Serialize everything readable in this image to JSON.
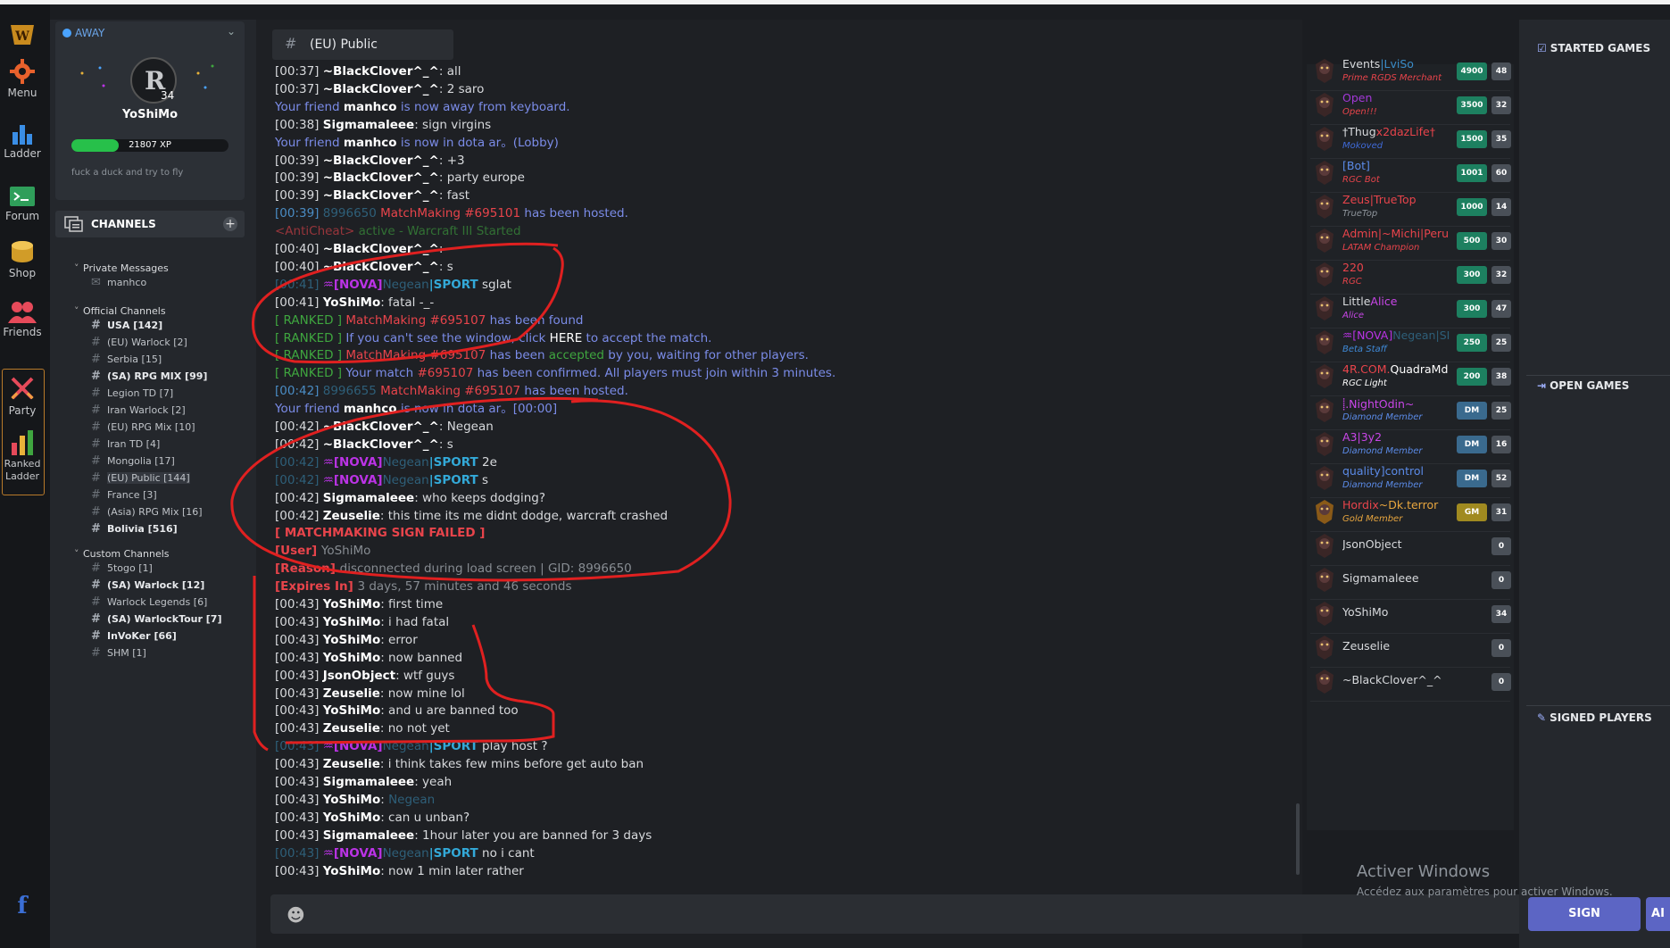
{
  "rail": {
    "items": [
      {
        "label": "",
        "icon": "warcraft-logo-icon"
      },
      {
        "label": "Menu",
        "icon": "gear-icon"
      },
      {
        "label": "Ladder",
        "icon": "bar-chart-icon"
      },
      {
        "label": "Forum",
        "icon": "terminal-icon"
      },
      {
        "label": "Shop",
        "icon": "coins-icon"
      },
      {
        "label": "Friends",
        "icon": "people-icon"
      },
      {
        "label": "Party",
        "icon": "crossed-swords-icon"
      },
      {
        "label": "Ranked",
        "label2": "Ladder",
        "icon": "ranked-bars-icon"
      }
    ],
    "facebook": "f"
  },
  "profile": {
    "status": "AWAY",
    "level": "34",
    "username": "YoShiMo",
    "xp_text": "21807 XP",
    "xp_progress": 0.3,
    "motto": "fuck a duck and try to fly"
  },
  "channels": {
    "header": "CHANNELS",
    "groups": [
      {
        "title": "Private Messages",
        "items": [
          {
            "name": "manhco"
          }
        ]
      },
      {
        "title": "Official Channels",
        "items": [
          {
            "name": "USA [142]",
            "bold": true
          },
          {
            "name": "(EU) Warlock [2]"
          },
          {
            "name": "Serbia [15]"
          },
          {
            "name": "(SA) RPG MIX [99]",
            "bold": true
          },
          {
            "name": "Legion TD [7]"
          },
          {
            "name": "Iran Warlock [2]"
          },
          {
            "name": "(EU) RPG Mix [10]"
          },
          {
            "name": "Iran TD [4]"
          },
          {
            "name": "Mongolia [17]"
          },
          {
            "name": "(EU) Public [144]",
            "selected": true
          },
          {
            "name": "France [3]"
          },
          {
            "name": "(Asia) RPG Mix [16]"
          },
          {
            "name": "Bolivia [516]",
            "bold": true
          }
        ]
      },
      {
        "title": "Custom Channels",
        "items": [
          {
            "name": "5togo [1]"
          },
          {
            "name": "(SA) Warlock [12]",
            "bold": true
          },
          {
            "name": "Warlock Legends [6]"
          },
          {
            "name": "(SA) WarlockTour [7]",
            "bold": true
          },
          {
            "name": "InVoKer [66]",
            "bold": true
          },
          {
            "name": "SHM [1]"
          }
        ]
      }
    ]
  },
  "chat": {
    "tab_title": "(EU) Public",
    "lines": [
      {
        "t": "[00:37] ",
        "n": "~BlackClover^_^",
        "x": ": all"
      },
      {
        "t": "[00:37] ",
        "n": "~BlackClover^_^",
        "x": ": 2 saro"
      },
      {
        "kind": "friend",
        "a": "Your friend ",
        "b": "manhco",
        "c": " is now away from keyboard."
      },
      {
        "t": "[00:38] ",
        "n": "Sigmamaleee",
        "x": ": sign virgins"
      },
      {
        "kind": "friend",
        "a": "Your friend ",
        "b": "manhco",
        "c": " is now in dota ar。(Lobby)"
      },
      {
        "t": "[00:39] ",
        "n": "~BlackClover^_^",
        "x": ": +3"
      },
      {
        "t": "[00:39] ",
        "n": "~BlackClover^_^",
        "x": ": party europe"
      },
      {
        "t": "[00:39] ",
        "n": "~BlackClover^_^",
        "x": ": fast"
      },
      {
        "kind": "host",
        "a": "[00:39] ",
        "b": "8996650",
        "c": " MatchMaking #695101",
        "d": " has been hosted."
      },
      {
        "kind": "anticheat",
        "a": "<AntiCheat> ",
        "b": "active",
        "c": " - Warcraft III Started"
      },
      {
        "t": "[00:40] ",
        "n": "~BlackClover^_^",
        "x": ": "
      },
      {
        "t": "[00:40] ",
        "n": "~BlackClover^_^",
        "x": ": s"
      },
      {
        "kind": "nova",
        "a": "[00:41] ",
        "b": "♒[NOVA]",
        "c": "Negean",
        "d": "|SPORT",
        "e": " sglat"
      },
      {
        "t": "[00:41] ",
        "n": "YoShiMo",
        "x": ": fatal -_-"
      },
      {
        "kind": "ranked",
        "a": "[ RANKED ] ",
        "b": "MatchMaking #695107",
        "c": " has been found",
        "d": ""
      },
      {
        "kind": "ranked2",
        "a": "[ RANKED ] ",
        "b": "If you can't see the window, click ",
        "c": "HERE",
        "d": " to accept the match."
      },
      {
        "kind": "ranked3",
        "a": "[ RANKED ] ",
        "b": "MatchMaking #695107",
        "c": " has been ",
        "d": "accepted",
        "e": " by you, waiting for other players."
      },
      {
        "kind": "ranked4",
        "a": "[ RANKED ] ",
        "b": "Your match ",
        "c": "#695107",
        "d": " has been confirmed. All players must join within 3 minutes."
      },
      {
        "kind": "host",
        "a": "[00:42] ",
        "b": "8996655",
        "c": " MatchMaking #695107",
        "d": " has been hosted."
      },
      {
        "kind": "friend2",
        "a": "Your friend ",
        "b": "manhco",
        "c": " is now in dota ar。",
        "d": "[00:00]"
      },
      {
        "t": "[00:42] ",
        "n": "~BlackClover^_^",
        "x": ": Negean"
      },
      {
        "t": "[00:42] ",
        "n": "~BlackClover^_^",
        "x": ": s"
      },
      {
        "kind": "nova",
        "a": "[00:42] ",
        "b": "♒[NOVA]",
        "c": "Negean",
        "d": "|SPORT",
        "e": " 2e"
      },
      {
        "kind": "nova",
        "a": "[00:42] ",
        "b": "♒[NOVA]",
        "c": "Negean",
        "d": "|SPORT",
        "e": " s"
      },
      {
        "t": "[00:42] ",
        "n": "Sigmamaleee",
        "x": ": who keeps dodging?"
      },
      {
        "t": "[00:42] ",
        "n": "Zeuselie",
        "x": ": this time its me didnt dodge, warcraft crashed"
      },
      {
        "kind": "fail",
        "a": "[ MATCHMAKING SIGN FAILED ]"
      },
      {
        "kind": "kv",
        "a": "[User] ",
        "b": "YoShiMo"
      },
      {
        "kind": "kv",
        "a": "[Reason] ",
        "b": "disconnected during load screen | GID: 8996650"
      },
      {
        "kind": "kv",
        "a": "[Expires In] ",
        "b": "3 days, 57 minutes and 46 seconds"
      },
      {
        "t": "[00:43] ",
        "n": "YoShiMo",
        "x": ": first time"
      },
      {
        "t": "[00:43] ",
        "n": "YoShiMo",
        "x": ": i had fatal"
      },
      {
        "t": "[00:43] ",
        "n": "YoShiMo",
        "x": ": error"
      },
      {
        "t": "[00:43] ",
        "n": "YoShiMo",
        "x": ": now banned"
      },
      {
        "t": "[00:43] ",
        "n": "JsonObject",
        "x": ": wtf guys"
      },
      {
        "t": "[00:43] ",
        "n": "Zeuselie",
        "x": ": now mine lol"
      },
      {
        "t": "[00:43] ",
        "n": "YoShiMo",
        "x": ": and u are banned too"
      },
      {
        "t": "[00:43] ",
        "n": "Zeuselie",
        "x": ": no not yet"
      },
      {
        "kind": "nova",
        "a": "[00:43] ",
        "b": "♒[NOVA]",
        "c": "Negean",
        "d": "|SPORT",
        "e": " play host ?"
      },
      {
        "t": "[00:43] ",
        "n": "Zeuselie",
        "x": ": i think takes few mins before get auto ban"
      },
      {
        "t": "[00:43] ",
        "n": "Sigmamaleee",
        "x": ": yeah"
      },
      {
        "kind": "mention",
        "a": "[00:43] ",
        "b": "YoShiMo",
        "c": ": ",
        "d": "Negean"
      },
      {
        "t": "[00:43] ",
        "n": "YoShiMo",
        "x": ": can u unban?"
      },
      {
        "t": "[00:43] ",
        "n": "Sigmamaleee",
        "x": ": 1hour later you are banned for 3 days"
      },
      {
        "kind": "nova",
        "a": "[00:43] ",
        "b": "♒[NOVA]",
        "c": "Negean",
        "d": "|SPORT",
        "e": " no i cant"
      },
      {
        "t": "[00:43] ",
        "n": "YoShiMo",
        "x": ": now 1 min later rather"
      }
    ],
    "input_placeholder": ""
  },
  "users": [
    {
      "name": "Events",
      "name_b": "|LviSo",
      "sub": "Prime RGDS Merchant",
      "sub_color": "#e8444b",
      "pts": "4900",
      "lvl": "48"
    },
    {
      "name": "Open",
      "name_b": "",
      "sub": "Open!!!",
      "sub_color": "#e8444b",
      "name_color": "#a338d8",
      "pts": "3500",
      "lvl": "32"
    },
    {
      "name": "†Thug",
      "name_b": "x2dazLife†",
      "sub": "Mokoved",
      "sub_color": "#3f6ad8",
      "pts": "1500",
      "lvl": "35"
    },
    {
      "name": "[Bot]",
      "name_b": "",
      "sub": "RGC Bot",
      "sub_color": "#e8444b",
      "name_color": "#5b8be8",
      "pts": "1001",
      "lvl": "60"
    },
    {
      "name": "Zeus|TrueTop",
      "name_b": "",
      "sub": "TrueTop",
      "sub_color": "#8e949b",
      "name_color": "#e8444b",
      "pts": "1000",
      "lvl": "14"
    },
    {
      "name": "Admin|~Michi|Peru",
      "name_b": "",
      "sub": "LATAM Champion",
      "sub_color": "#e8444b",
      "name_color": "#e8444b",
      "pts": "500",
      "lvl": "30"
    },
    {
      "name": "220",
      "name_b": "",
      "sub": "RGC",
      "sub_color": "#e8444b",
      "name_color": "#e8444b",
      "pts": "300",
      "lvl": "32"
    },
    {
      "name": "Little",
      "name_b": "Alice",
      "sub": "Alice",
      "sub_color": "#c946e8",
      "pts": "300",
      "lvl": "47"
    },
    {
      "name": "♒[NOVA]",
      "name_b": "Negean|SI",
      "sub": "Beta Staff",
      "sub_color": "#3f8ad8",
      "name_color": "#bb33e6",
      "pts": "250",
      "lvl": "25"
    },
    {
      "name": "4R.COM.",
      "name_b": "QuadraMd",
      "sub": "RGC Light",
      "sub_color": "#ffffff",
      "name_color": "#e8444b",
      "pts": "200",
      "lvl": "38"
    },
    {
      "name": "⸽.NightOdin~",
      "name_b": "",
      "sub": "Diamond Member",
      "sub_color": "#5b8be8",
      "name_color": "#c946e8",
      "pts": "DM",
      "lvl": "25",
      "badge": "dm"
    },
    {
      "name": "A3|3y2",
      "name_b": "",
      "sub": "Diamond Member",
      "sub_color": "#5b8be8",
      "name_color": "#c946e8",
      "pts": "DM",
      "lvl": "16",
      "badge": "dm"
    },
    {
      "name": "quality]control",
      "name_b": "",
      "sub": "Diamond Member",
      "sub_color": "#5b8be8",
      "name_color": "#5b8be8",
      "pts": "DM",
      "lvl": "52",
      "badge": "dm"
    },
    {
      "name": "Hordix",
      "name_b": "~Dk.terror",
      "sub": "Gold Member",
      "sub_color": "#e8a63f",
      "name_color": "#e8444b",
      "pts": "GM",
      "lvl": "31",
      "badge": "gm"
    },
    {
      "name": "JsonObject",
      "name_b": "",
      "sub": "",
      "pts": "",
      "lvl": "0"
    },
    {
      "name": "Sigmamaleee",
      "name_b": "",
      "sub": "",
      "pts": "",
      "lvl": "0"
    },
    {
      "name": "YoShiMo",
      "name_b": "",
      "sub": "",
      "pts": "",
      "lvl": "34"
    },
    {
      "name": "Zeuselie",
      "name_b": "",
      "sub": "",
      "pts": "",
      "lvl": "0"
    },
    {
      "name": "~BlackClover^_^",
      "name_b": "",
      "sub": "",
      "pts": "",
      "lvl": "0"
    }
  ],
  "right": {
    "started": "STARTED GAMES",
    "open": "OPEN GAMES",
    "signed": "SIGNED PLAYERS",
    "sign_button": "SIGN",
    "second_button": "AI"
  },
  "watermark": {
    "line1": "Activer Windows",
    "line2": "Accédez aux paramètres pour activer Windows."
  },
  "colors": {
    "accent": "#5c65c4",
    "xp": "#27c04a",
    "online": "#4aa3ff"
  }
}
